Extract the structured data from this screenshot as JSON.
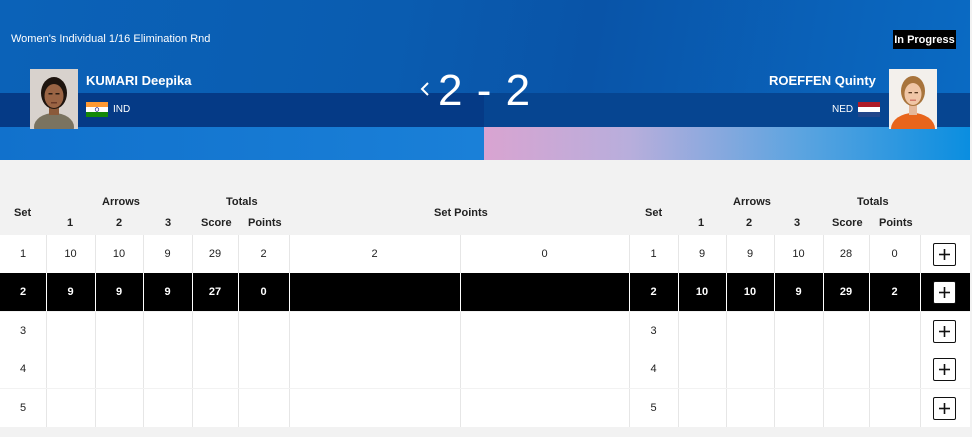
{
  "header": {
    "event": "Women's Individual 1/16 Elimination Rnd",
    "status": "In Progress",
    "score": "2 - 2",
    "left_athlete": {
      "name": "KUMARI Deepika",
      "noc": "IND",
      "flag": "india-flag"
    },
    "right_athlete": {
      "name": "ROEFFEN Quinty",
      "noc": "NED",
      "flag": "netherlands-flag"
    }
  },
  "table_header": {
    "set": "Set",
    "arrows": "Arrows",
    "arrow_1": "1",
    "arrow_2": "2",
    "arrow_3": "3",
    "totals": "Totals",
    "score": "Score",
    "points": "Points",
    "set_points": "Set Points"
  },
  "rows": [
    {
      "set": "1",
      "left": [
        "10",
        "10",
        "9",
        "29",
        "2"
      ],
      "set_points": [
        "2",
        "0"
      ],
      "right": [
        "9",
        "9",
        "10",
        "28",
        "0"
      ]
    },
    {
      "set": "2",
      "left": [
        "9",
        "9",
        "9",
        "27",
        "0"
      ],
      "set_points": [
        "",
        ""
      ],
      "right": [
        "10",
        "10",
        "9",
        "29",
        "2"
      ]
    },
    {
      "set": "3",
      "left": [
        "",
        "",
        "",
        "",
        ""
      ],
      "set_points": [
        "",
        ""
      ],
      "right": [
        "",
        "",
        "",
        "",
        ""
      ]
    },
    {
      "set": "4",
      "left": [
        "",
        "",
        "",
        "",
        ""
      ],
      "set_points": [
        "",
        ""
      ],
      "right": [
        "",
        "",
        "",
        "",
        ""
      ]
    },
    {
      "set": "5",
      "left": [
        "",
        "",
        "",
        "",
        ""
      ],
      "set_points": [
        "",
        ""
      ],
      "right": [
        "",
        "",
        "",
        "",
        ""
      ]
    }
  ],
  "active_row": 1,
  "colors": {
    "header_blue": "#0a5cb0",
    "active_row": "#000000",
    "badge": "#000000"
  }
}
